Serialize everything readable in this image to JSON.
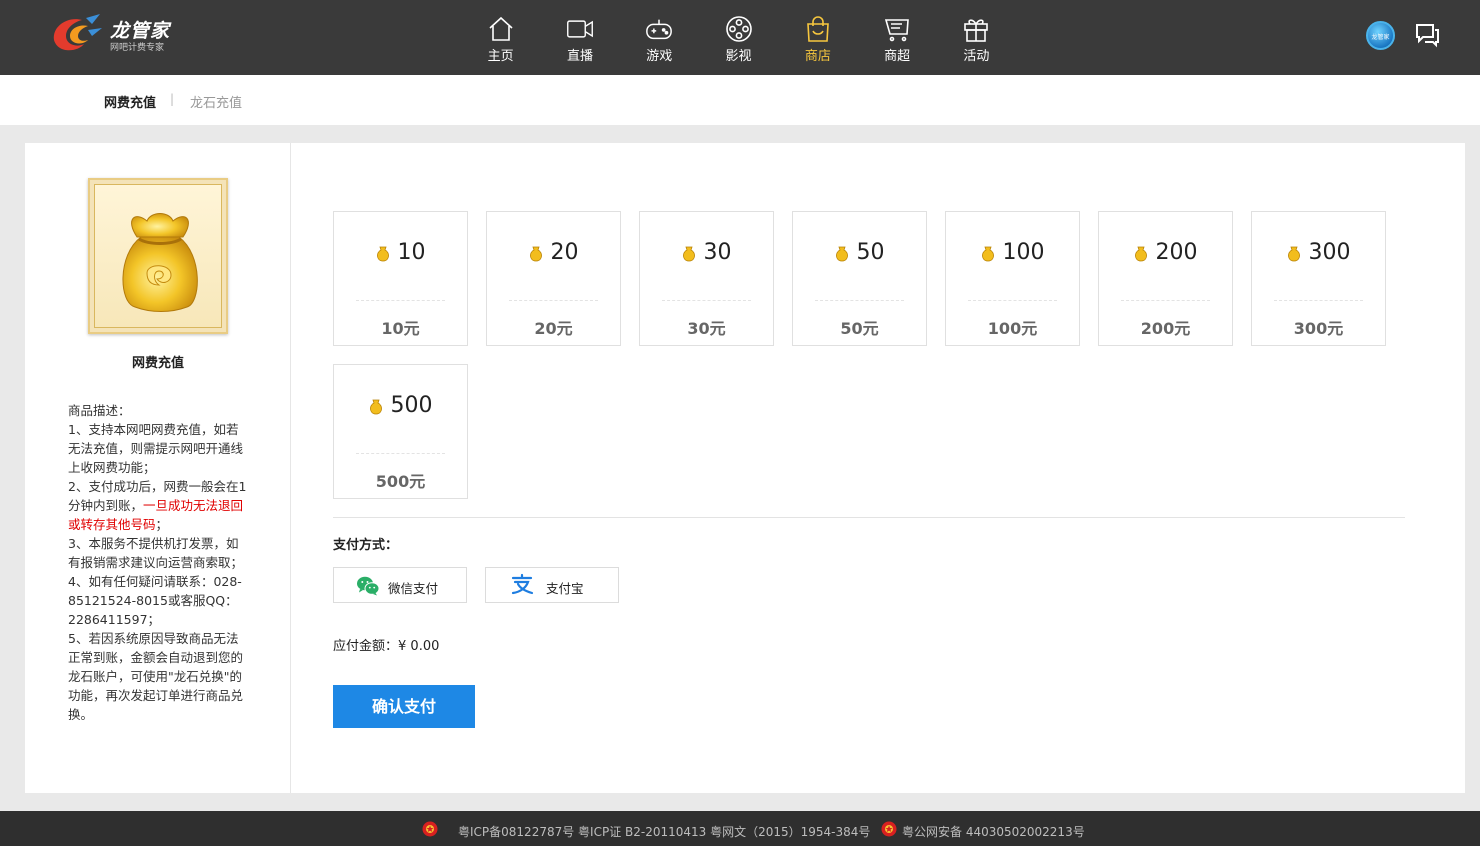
{
  "brand": {
    "name": "龙管家",
    "slogan": "网吧计费专家"
  },
  "nav": [
    {
      "label": "主页",
      "icon": "home-icon"
    },
    {
      "label": "直播",
      "icon": "video-camera-icon"
    },
    {
      "label": "游戏",
      "icon": "gamepad-icon"
    },
    {
      "label": "影视",
      "icon": "film-reel-icon"
    },
    {
      "label": "商店",
      "icon": "shopping-bag-icon",
      "active": true
    },
    {
      "label": "商超",
      "icon": "mall-icon"
    },
    {
      "label": "活动",
      "icon": "gift-icon"
    }
  ],
  "avatar_text": "龙管家",
  "tabs": {
    "first": "网费充值",
    "second": "龙石充值",
    "separator": "|"
  },
  "product": {
    "name": "网费充值",
    "description_title": "商品描述：",
    "line1": "1、支持本网吧网费充值，如若无法充值，则需提示网吧开通线上收网费功能；",
    "line2_a": "2、支付成功后，网费一般会在1分钟内到账，",
    "line2_red": "一旦成功无法退回或转存其他号码",
    "line2_b": "；",
    "line3": "3、本服务不提供机打发票，如有报销需求建议向运营商索取；",
    "line4": "4、如有任何疑问请联系：028-85121524-8015或客服QQ：2286411597；",
    "line5": "5、若因系统原因导致商品无法正常到账，金额会自动退到您的龙石账户，可使用\"龙石兑换\"的功能，再次发起订单进行商品兑换。"
  },
  "amount_options": [
    {
      "value": "10",
      "price": "10元"
    },
    {
      "value": "20",
      "price": "20元"
    },
    {
      "value": "30",
      "price": "30元"
    },
    {
      "value": "50",
      "price": "50元"
    },
    {
      "value": "100",
      "price": "100元"
    },
    {
      "value": "200",
      "price": "200元"
    },
    {
      "value": "300",
      "price": "300元"
    },
    {
      "value": "500",
      "price": "500元"
    }
  ],
  "payment": {
    "title": "支付方式：",
    "wechat": "微信支付",
    "alipay": "支付宝",
    "amount_label": "应付金额：",
    "amount_value": "¥ 0.00",
    "confirm": "确认支付"
  },
  "footer": {
    "icp": "粤ICP备08122787号  粤ICP证 B2-20110413  粤网文（2015）1954-384号",
    "police": "粤公网安备 44030502002213号"
  },
  "colors": {
    "topbar": "#3a3a3a",
    "active": "#f7c73e",
    "primary": "#1e88e5",
    "warning": "#e00000"
  }
}
